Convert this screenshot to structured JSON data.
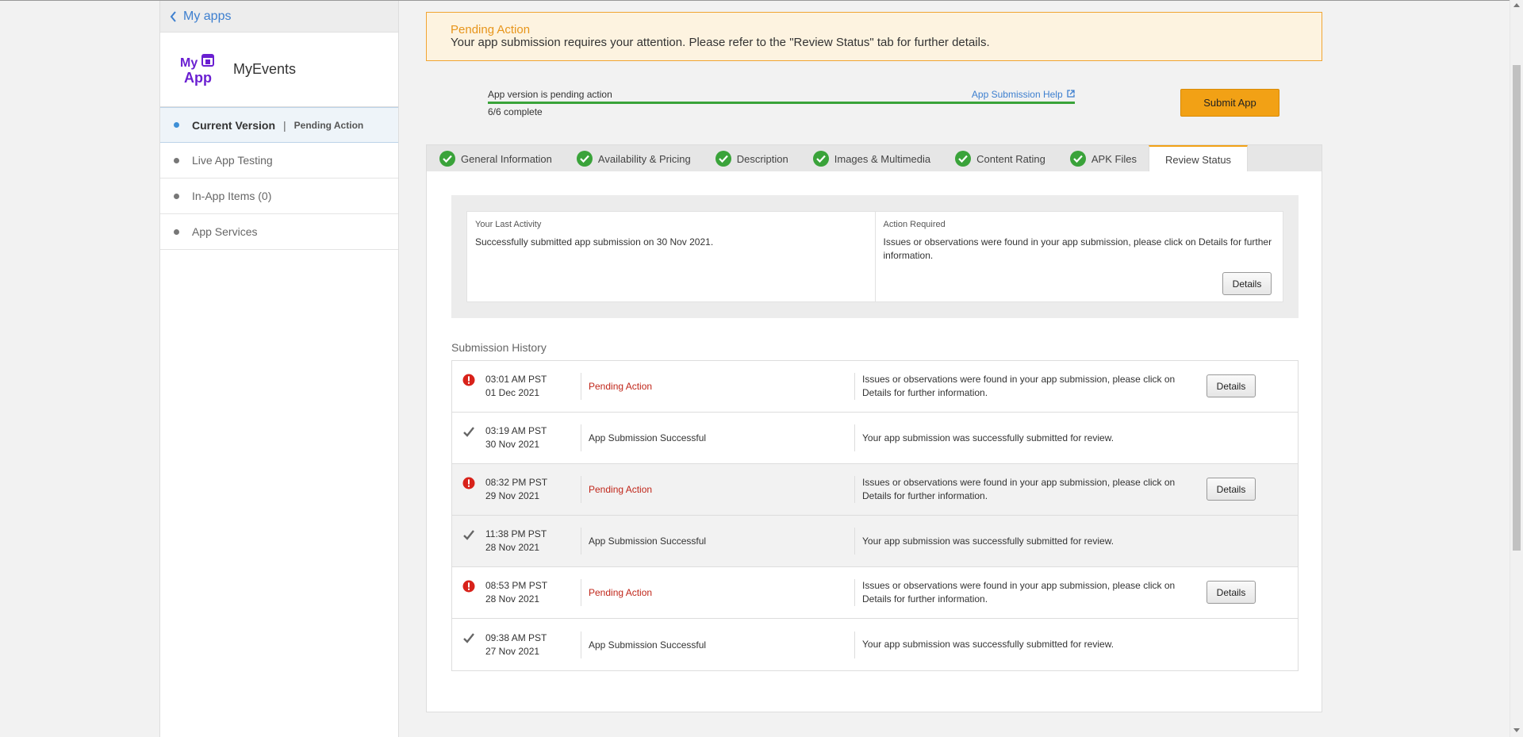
{
  "sidebar": {
    "back_label": "My apps",
    "app_name": "MyEvents",
    "logo_text_top": "My",
    "logo_text_bottom": "App",
    "items": [
      {
        "label": "Current Version",
        "sub": "Pending Action"
      },
      {
        "label": "Live App Testing"
      },
      {
        "label": "In-App Items (0)"
      },
      {
        "label": "App Services"
      }
    ]
  },
  "alert": {
    "title": "Pending Action",
    "text": "Your app submission requires your attention. Please refer to the \"Review Status\" tab for further details."
  },
  "progress": {
    "status": "App version is pending action",
    "help_link": "App Submission Help",
    "count": "6/6 complete",
    "fraction": 1.0
  },
  "submit_button": "Submit App",
  "tabs": [
    {
      "label": "General Information",
      "complete": true
    },
    {
      "label": "Availability & Pricing",
      "complete": true
    },
    {
      "label": "Description",
      "complete": true
    },
    {
      "label": "Images & Multimedia",
      "complete": true
    },
    {
      "label": "Content Rating",
      "complete": true
    },
    {
      "label": "APK Files",
      "complete": true
    },
    {
      "label": "Review Status",
      "complete": false,
      "active": true
    }
  ],
  "activity": {
    "last_label": "Your Last Activity",
    "last_text": "Successfully submitted app submission on 30 Nov 2021.",
    "action_label": "Action Required",
    "action_text": "Issues or observations were found in your app submission, please click on Details for further information.",
    "details": "Details"
  },
  "history": {
    "title": "Submission History",
    "details_label": "Details",
    "rows": [
      {
        "time": "03:01 AM PST",
        "date": "01 Dec 2021",
        "status": "Pending Action",
        "type": "pending",
        "message": "Issues or observations were found in your app submission, please click on Details for further information."
      },
      {
        "time": "03:19 AM PST",
        "date": "30 Nov 2021",
        "status": "App Submission Successful",
        "type": "success",
        "message": "Your app submission was successfully submitted for review."
      },
      {
        "time": "08:32 PM PST",
        "date": "29 Nov 2021",
        "status": "Pending Action",
        "type": "pending",
        "message": "Issues or observations were found in your app submission, please click on Details for further information."
      },
      {
        "time": "11:38 PM PST",
        "date": "28 Nov 2021",
        "status": "App Submission Successful",
        "type": "success",
        "message": "Your app submission was successfully submitted for review."
      },
      {
        "time": "08:53 PM PST",
        "date": "28 Nov 2021",
        "status": "Pending Action",
        "type": "pending",
        "message": "Issues or observations were found in your app submission, please click on Details for further information."
      },
      {
        "time": "09:38 AM PST",
        "date": "27 Nov 2021",
        "status": "App Submission Successful",
        "type": "success",
        "message": "Your app submission was successfully submitted for review."
      }
    ]
  },
  "colors": {
    "accent": "#f2a115",
    "link": "#3d7fcf",
    "pending": "#c0261a",
    "success_check": "#3aa33a",
    "logo": "#6a1fd1"
  }
}
